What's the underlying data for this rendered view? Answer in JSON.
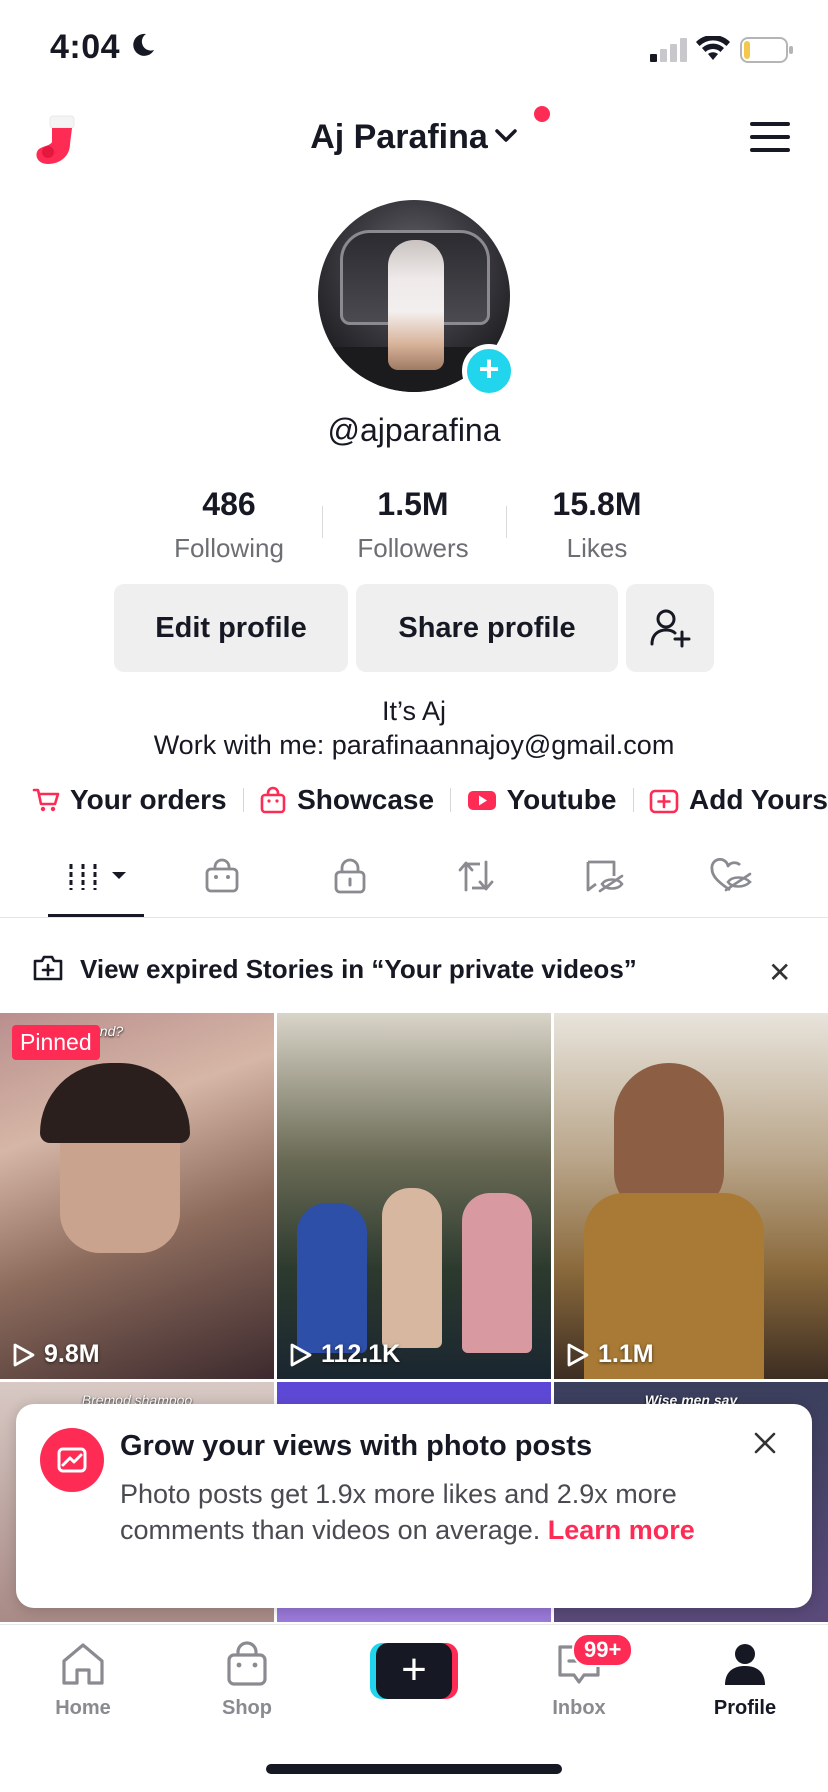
{
  "status": {
    "time": "4:04"
  },
  "header": {
    "title": "Aj Parafina"
  },
  "profile": {
    "handle": "@ajparafina",
    "stats": [
      {
        "value": "486",
        "label": "Following"
      },
      {
        "value": "1.5M",
        "label": "Followers"
      },
      {
        "value": "15.8M",
        "label": "Likes"
      }
    ],
    "edit_label": "Edit profile",
    "share_label": "Share profile",
    "bio_line1": "It’s Aj",
    "bio_line2": "Work with me: parafinaannajoy@gmail.com"
  },
  "links": [
    {
      "label": "Your orders",
      "icon": "cart-icon"
    },
    {
      "label": "Showcase",
      "icon": "shopping-bag-icon"
    },
    {
      "label": "Youtube",
      "icon": "youtube-icon"
    },
    {
      "label": "Add Yours",
      "icon": "add-yours-icon"
    }
  ],
  "tabs": [
    "videos-grid",
    "shop",
    "private",
    "reposts",
    "favorites-hidden",
    "liked-hidden"
  ],
  "expired_banner": {
    "text": "View expired Stories in “Your private videos”"
  },
  "videos": [
    {
      "views": "9.8M",
      "pinned": "Pinned",
      "caption": "end?"
    },
    {
      "views": "112.1K"
    },
    {
      "views": "1.1M"
    },
    {
      "caption": "Bremod shampoo"
    },
    {},
    {
      "caption": "Wise men say"
    }
  ],
  "popup": {
    "title": "Grow your views with photo posts",
    "body": "Photo posts get 1.9x more likes and 2.9x more comments than videos on average.",
    "link": "Learn more"
  },
  "nav": {
    "home": "Home",
    "shop": "Shop",
    "inbox": "Inbox",
    "profile": "Profile",
    "inbox_badge": "99+"
  },
  "colors": {
    "accent": "#fe2c55",
    "teal": "#20d5ec",
    "text": "#161823"
  }
}
